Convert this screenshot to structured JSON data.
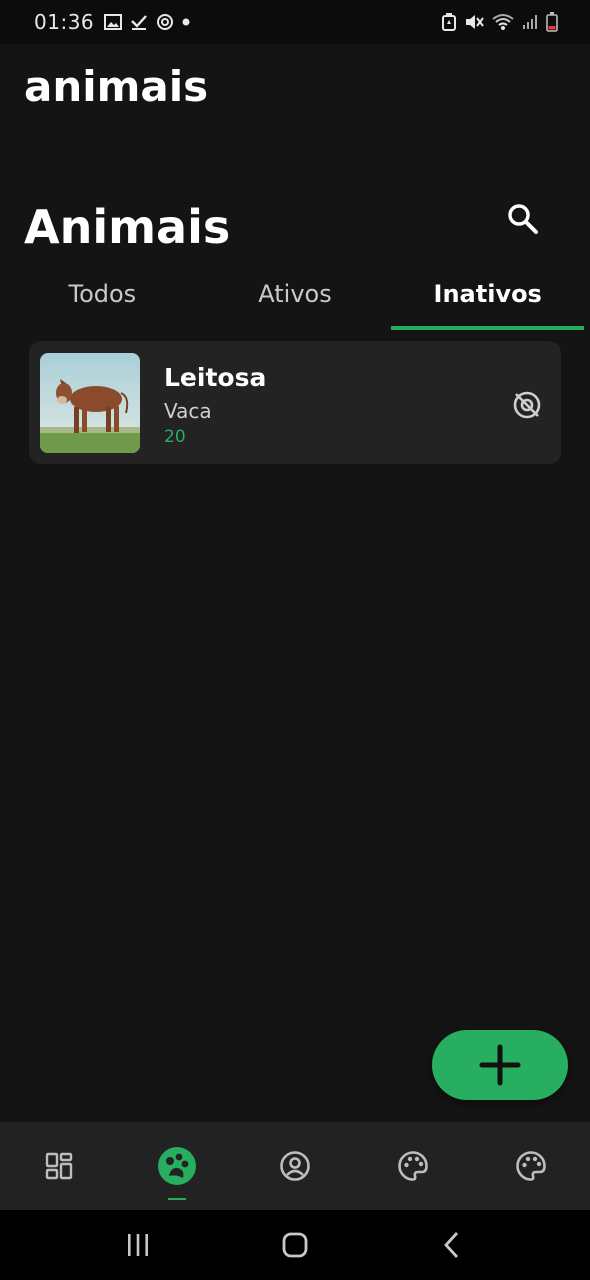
{
  "status_bar": {
    "time": "01:36",
    "left_icons": [
      "gallery-icon",
      "check-icon",
      "sync-icon",
      "dot-icon"
    ],
    "right_icons": [
      "battery-saver-icon",
      "mute-icon",
      "wifi-icon",
      "signal-icon",
      "battery-icon"
    ]
  },
  "app": {
    "title": "animais"
  },
  "page": {
    "title": "Animais",
    "search_icon": "search-icon"
  },
  "tabs": [
    {
      "label": "Todos",
      "active": false
    },
    {
      "label": "Ativos",
      "active": false
    },
    {
      "label": "Inativos",
      "active": true
    }
  ],
  "animals": [
    {
      "name": "Leitosa",
      "species": "Vaca",
      "age": "20",
      "status_icon": "visibility-off-icon"
    }
  ],
  "fab": {
    "icon": "plus-icon"
  },
  "bottom_nav": [
    {
      "icon": "dashboard-icon",
      "active": false
    },
    {
      "icon": "animals-icon",
      "active": true
    },
    {
      "icon": "profile-icon",
      "active": false
    },
    {
      "icon": "palette-icon",
      "active": false
    },
    {
      "icon": "palette-icon",
      "active": false
    }
  ],
  "system_nav": [
    "recents-icon",
    "home-icon",
    "back-icon"
  ],
  "colors": {
    "accent": "#27ae60",
    "background": "#141414",
    "card": "#232323",
    "nav": "#222222"
  }
}
